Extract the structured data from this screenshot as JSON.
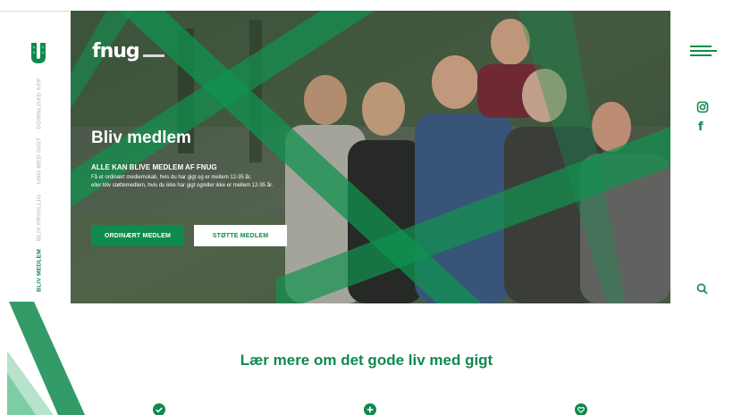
{
  "sidebar": {
    "nav": [
      {
        "label": "DOWNLOAD APP",
        "active": false
      },
      {
        "label": "UNG MED GIGT",
        "active": false
      },
      {
        "label": "BLIV FRIVILLIG",
        "active": false
      },
      {
        "label": "BLIV MEDLEM",
        "active": true
      }
    ]
  },
  "hero": {
    "logo_text": "fnug",
    "title": "Bliv medlem",
    "subtitle": "ALLE KAN BLIVE MEDLEM AF FNUG",
    "text_line1": "Få et ordinært medlemskab, hvis du har gigt og er mellem 12-35 år,",
    "text_line2": "eller bliv støttemedlem, hvis du ikke har gigt og/eller ikke er mellem 12-35 år.",
    "button_primary": "ORDINÆRT MEDLEM",
    "button_secondary": "STØTTE MEDLEM"
  },
  "section": {
    "title": "Lær mere om det gode liv med gigt"
  },
  "icons": {
    "menu": "hamburger-menu-icon",
    "instagram": "instagram-icon",
    "facebook": "facebook-icon",
    "facebook_glyph": "f",
    "search": "search-icon",
    "features": [
      "check-circle-icon",
      "plus-circle-icon",
      "heart-circle-icon"
    ]
  },
  "colors": {
    "brand_green": "#0f8a4e",
    "muted_nav": "#c8c8c8"
  }
}
